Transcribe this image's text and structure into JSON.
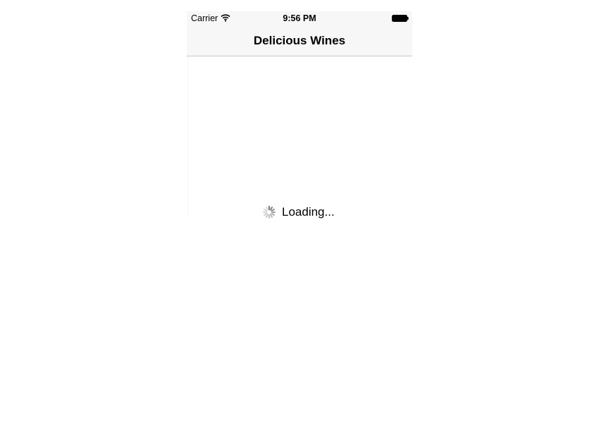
{
  "status_bar": {
    "carrier": "Carrier",
    "time": "9:56 PM",
    "icons": [
      "wifi-icon",
      "battery-icon"
    ]
  },
  "nav_bar": {
    "title": "Delicious Wines"
  },
  "content": {
    "loading_label": "Loading...",
    "icon": "activity-spinner-icon"
  }
}
